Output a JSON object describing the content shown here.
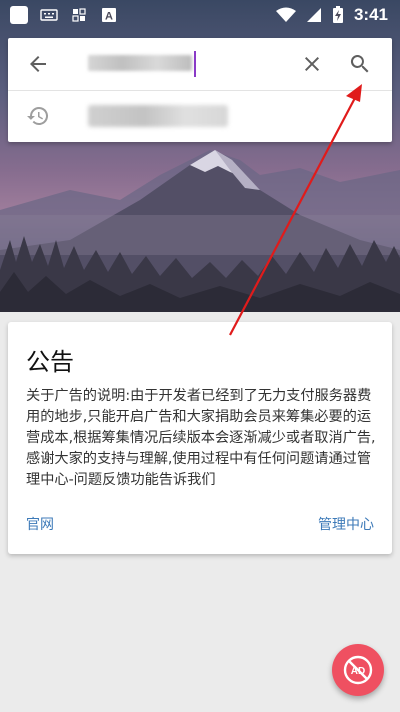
{
  "status_bar": {
    "time": "3:41",
    "icons": [
      "app-icon",
      "keyboard-icon",
      "notification-icon",
      "a-icon",
      "wifi-icon",
      "signal-icon",
      "battery-charging-icon"
    ]
  },
  "search": {
    "value": "",
    "placeholder": "",
    "back_icon": "arrow-back-icon",
    "clear_icon": "close-icon",
    "search_icon": "search-icon",
    "history_icon": "history-icon",
    "history_item": ""
  },
  "notice": {
    "title": "公告",
    "body": "关于广告的说明:由于开发者已经到了无力支付服务器费用的地步,只能开启广告和大家捐助会员来筹集必要的运营成本,根据筹集情况后续版本会逐渐减少或者取消广告,感谢大家的支持与理解,使用过程中有任何问题请通过管理中心-问题反馈功能告诉我们",
    "link_official": "官网",
    "link_admin": "管理中心"
  },
  "fab": {
    "icon": "no-ads-icon"
  },
  "colors": {
    "accent_link": "#3d7ab8",
    "fab": "#ef5061",
    "cursor": "#8a3ac7",
    "annotation_arrow": "#e01b1b"
  }
}
